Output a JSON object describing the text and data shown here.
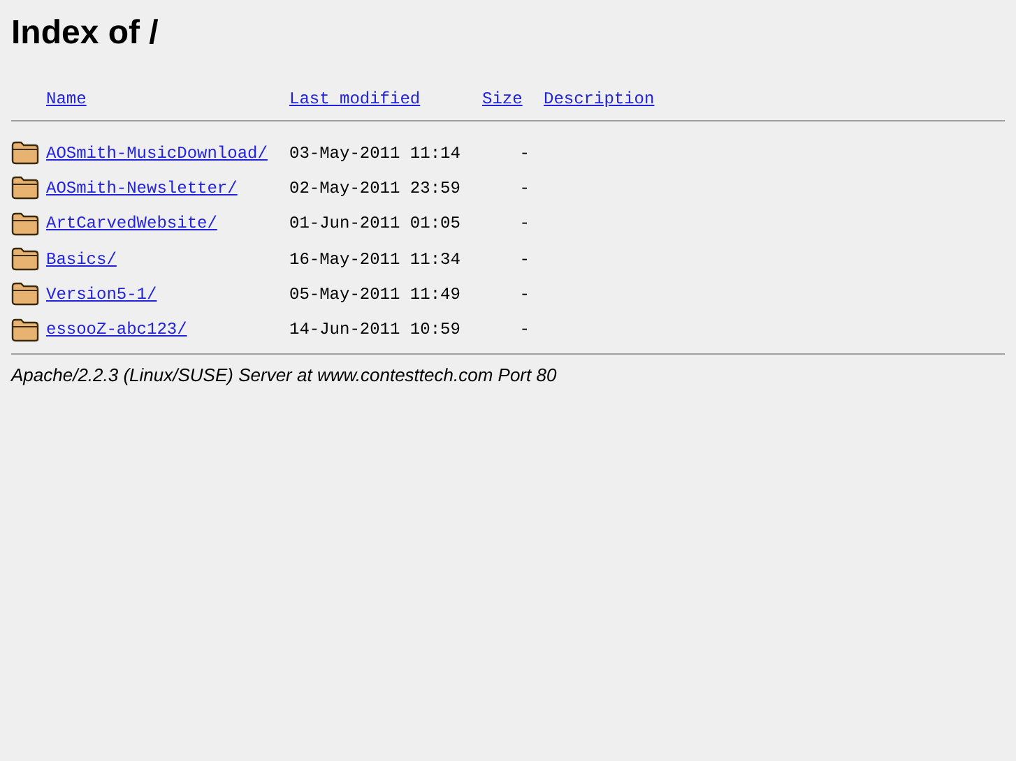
{
  "title": "Index of /",
  "columns": [
    "Name",
    "Last modified",
    "Size",
    "Description"
  ],
  "rows": [
    {
      "name": "AOSmith-MusicDownload/",
      "modified": "03-May-2011 11:14",
      "size": "-"
    },
    {
      "name": "AOSmith-Newsletter/",
      "modified": "02-May-2011 23:59",
      "size": "-"
    },
    {
      "name": "ArtCarvedWebsite/",
      "modified": "01-Jun-2011 01:05",
      "size": "-"
    },
    {
      "name": "Basics/",
      "modified": "16-May-2011 11:34",
      "size": "-"
    },
    {
      "name": "Version5-1/",
      "modified": "05-May-2011 11:49",
      "size": "-"
    },
    {
      "name": "essooZ-abc123/",
      "modified": "14-Jun-2011 10:59",
      "size": "-"
    }
  ],
  "footer": "Apache/2.2.3 (Linux/SUSE) Server at www.contesttech.com Port 80"
}
